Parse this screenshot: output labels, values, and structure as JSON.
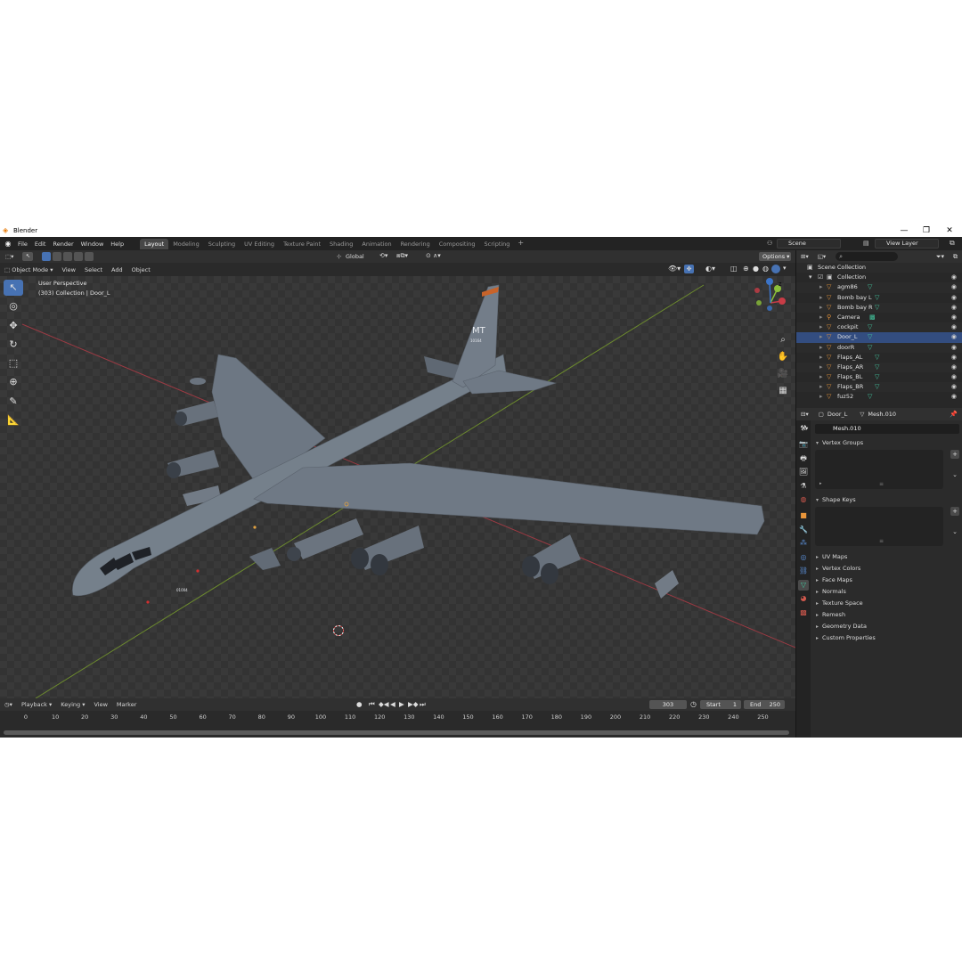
{
  "window": {
    "title": "Blender",
    "controls": [
      "—",
      "❐",
      "✕"
    ]
  },
  "menu": {
    "items": [
      "File",
      "Edit",
      "Render",
      "Window",
      "Help"
    ]
  },
  "workspaces": [
    "Layout",
    "Modeling",
    "Sculpting",
    "UV Editing",
    "Texture Paint",
    "Shading",
    "Animation",
    "Rendering",
    "Compositing",
    "Scripting"
  ],
  "active_workspace": "Layout",
  "scene": "Scene",
  "view_layer": "View Layer",
  "viewport_header": {
    "mode": "Object Mode",
    "menus": [
      "View",
      "Select",
      "Add",
      "Object"
    ],
    "orientation": "Global",
    "options": "Options"
  },
  "viewport": {
    "perspective": "User Perspective",
    "collection_info": "(303) Collection | Door_L",
    "tail_text": "MT",
    "tail_number": "10164",
    "nose_number": "01004"
  },
  "gizmo_axes": [
    "X",
    "Y",
    "Z"
  ],
  "timeline": {
    "menus": [
      "Playback",
      "Keying",
      "View",
      "Marker"
    ],
    "current_frame": "303",
    "start_label": "Start",
    "start": "1",
    "end_label": "End",
    "end": "250",
    "ticks": [
      "0",
      "10",
      "20",
      "30",
      "40",
      "50",
      "60",
      "70",
      "80",
      "90",
      "100",
      "110",
      "120",
      "130",
      "140",
      "150",
      "160",
      "170",
      "180",
      "190",
      "200",
      "210",
      "220",
      "230",
      "240",
      "250"
    ]
  },
  "outliner": {
    "root": "Scene Collection",
    "collection": "Collection",
    "items": [
      "agm86",
      "Bomb bay L",
      "Bomb bay R",
      "Camera",
      "cockpit",
      "Door_L",
      "doorR",
      "Flaps_AL",
      "Flaps_AR",
      "Flaps_BL",
      "Flaps_BR",
      "fuz52"
    ]
  },
  "properties": {
    "object": "Door_L",
    "mesh": "Mesh.010",
    "mesh_name": "Mesh.010",
    "open_panels": [
      "Vertex Groups",
      "Shape Keys"
    ],
    "closed_panels": [
      "UV Maps",
      "Vertex Colors",
      "Face Maps",
      "Normals",
      "Texture Space",
      "Remesh",
      "Geometry Data",
      "Custom Properties"
    ]
  },
  "colors": {
    "accent": "#4772b3",
    "object_icon": "#e8953a",
    "mesh_data_icon": "#43c59e",
    "x_axis": "#c83c46",
    "y_axis": "#8bbf3a",
    "z_axis": "#3c74c8"
  }
}
